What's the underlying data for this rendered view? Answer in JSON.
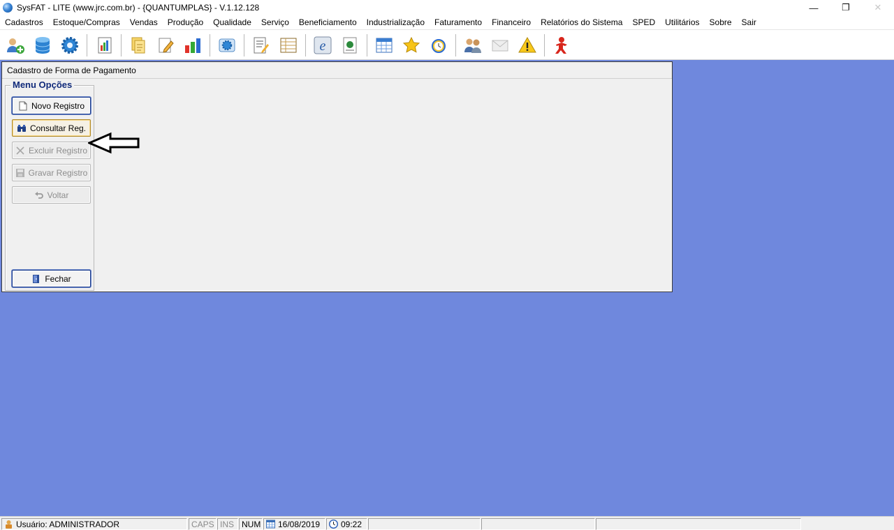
{
  "window": {
    "title": "SysFAT - LITE (www.jrc.com.br) - {QUANTUMPLAS} - V.1.12.128",
    "minimize": "—",
    "restore": "❐",
    "close": "✕"
  },
  "menubar": {
    "items": [
      {
        "label": "Cadastros"
      },
      {
        "label": "Estoque/Compras"
      },
      {
        "label": "Vendas"
      },
      {
        "label": "Produção"
      },
      {
        "label": "Qualidade"
      },
      {
        "label": "Serviço"
      },
      {
        "label": "Beneficiamento"
      },
      {
        "label": "Industrialização"
      },
      {
        "label": "Faturamento"
      },
      {
        "label": "Financeiro"
      },
      {
        "label": "Relatórios do Sistema"
      },
      {
        "label": "SPED"
      },
      {
        "label": "Utilitários"
      },
      {
        "label": "Sobre"
      },
      {
        "label": "Sair"
      }
    ]
  },
  "toolbar": {
    "icons": [
      "users-add-icon",
      "database-icon",
      "gear-icon",
      "chart-report-icon",
      "documents-icon",
      "edit-document-icon",
      "bar-chart-icon",
      "settings-disk-icon",
      "notepad-edit-icon",
      "table-list-icon",
      "nfe-icon",
      "globe-document-icon",
      "calendar-icon",
      "star-icon",
      "alarm-clock-icon",
      "users-chat-icon",
      "mail-icon",
      "warning-icon",
      "exit-person-icon"
    ]
  },
  "child_window": {
    "title": "Cadastro de Forma de Pagamento",
    "menu_group": {
      "legend": "Menu Opções",
      "buttons": {
        "novo": "Novo Registro",
        "consultar": "Consultar Reg.",
        "excluir": "Excluir Registro",
        "gravar": "Gravar Registro",
        "voltar": "Voltar",
        "fechar": "Fechar"
      }
    }
  },
  "statusbar": {
    "user": "Usuário: ADMINISTRADOR",
    "caps": "CAPS",
    "ins": "INS",
    "num": "NUM",
    "date": "16/08/2019",
    "time": "09:22"
  },
  "colors": {
    "mdi_background": "#6f88dd",
    "legend_text": "#102a7a"
  }
}
